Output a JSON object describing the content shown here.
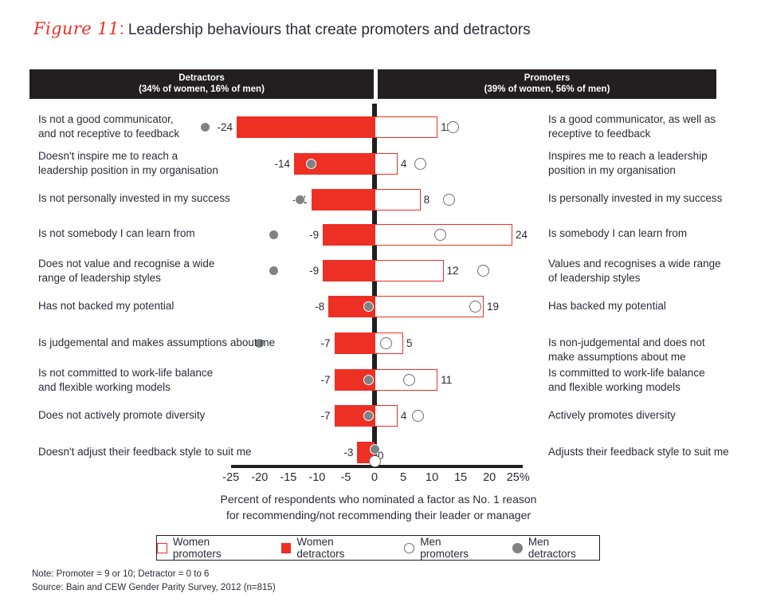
{
  "title": {
    "figure_number": "Figure 11",
    "colon": ":",
    "text": "Leadership behaviours that create promoters and detractors"
  },
  "header": {
    "detractors_title": "Detractors",
    "detractors_sub": "(34% of women, 16% of men)",
    "promoters_title": "Promoters",
    "promoters_sub": "(39% of women, 56% of men)"
  },
  "axis": {
    "ticks": [
      "-25",
      "-20",
      "-15",
      "-10",
      "-5",
      "0",
      "5",
      "10",
      "15",
      "20",
      "25%"
    ],
    "tick_values": [
      -25,
      -20,
      -15,
      -10,
      -5,
      0,
      5,
      10,
      15,
      20,
      25
    ],
    "caption_line1": "Percent of respondents who nominated a factor as No. 1 reason",
    "caption_line2": "for recommending/not recommending their leader or manager"
  },
  "legend": {
    "items": [
      {
        "label": "Women promoters",
        "swatch": "square-outline-red-icon",
        "color": "#ee2f24"
      },
      {
        "label": "Women detractors",
        "swatch": "square-filled-red-icon",
        "color": "#ee2f24"
      },
      {
        "label": "Men promoters",
        "swatch": "circle-outline-gray-icon",
        "color": "#6d6e71"
      },
      {
        "label": "Men detractors",
        "swatch": "circle-filled-gray-icon",
        "color": "#808284"
      }
    ]
  },
  "footnotes": {
    "note": "Note: Promoter = 9 or 10; Detractor = 0 to 6",
    "source": "Source: Bain and CEW Gender Parity Survey, 2012 (n=815)"
  },
  "colors": {
    "red": "#ee2f24",
    "black": "#231f20",
    "gray_marker": "#808284",
    "text": "#2b2b3a"
  },
  "chart_data": {
    "type": "bar",
    "orientation": "horizontal-diverging",
    "title": "Leadership behaviours that create promoters and detractors",
    "xlabel": "Percent of respondents who nominated a factor as No. 1 reason for recommending/not recommending their leader or manager",
    "ylabel": "",
    "xlim": [
      -25,
      25
    ],
    "grid": false,
    "legend_position": "bottom",
    "categories_left": [
      "Is not a good communicator, and not receptive to feedback",
      "Doesn't inspire me to reach a leadership position in my organisation",
      "Is not personally invested in my success",
      "Is not somebody I can learn from",
      "Does not value and recognise a wide range of leadership styles",
      "Has not backed my potential",
      "Is judgemental and makes assumptions about me",
      "Is not committed to work-life balance and flexible working models",
      "Does not actively promote diversity",
      "Doesn't adjust their feedback style to suit me"
    ],
    "categories_right": [
      "Is a good communicator, as well as receptive to feedback",
      "Inspires me to reach a leadership position in my organisation",
      "Is personally invested in my success",
      "Is somebody I can learn from",
      "Values and recognises a wide range of leadership styles",
      "Has backed my potential",
      "Is non-judgemental and does not make assumptions about me",
      "Is committed to work-life balance and flexible working models",
      "Actively promotes diversity",
      "Adjusts their feedback style to suit me"
    ],
    "series": [
      {
        "name": "Women detractors",
        "type": "bar",
        "values": [
          -24,
          -14,
          -11,
          -9,
          -9,
          -8,
          -7,
          -7,
          -7,
          -3
        ]
      },
      {
        "name": "Women promoters",
        "type": "bar",
        "values": [
          11,
          4,
          8,
          24,
          12,
          19,
          5,
          11,
          4,
          0
        ]
      },
      {
        "name": "Men detractors",
        "type": "marker",
        "values": [
          -29.5,
          -11,
          -13,
          -17.5,
          -17.5,
          -1,
          -20,
          -1,
          -1,
          0
        ]
      },
      {
        "name": "Men promoters",
        "type": "marker",
        "values": [
          13.6,
          8,
          13,
          11.5,
          19,
          17.5,
          2,
          6,
          7.5,
          0
        ]
      }
    ]
  },
  "rows": [
    {
      "left": "Is not a good communicator,\nand not receptive to feedback",
      "right": "Is a good communicator, as well as\nreceptive to feedback",
      "neg_label": "-24",
      "pos_label": "11"
    },
    {
      "left": "Doesn't inspire me to reach a\nleadership position in my organisation",
      "right": "Inspires me to reach a leadership\nposition in my organisation",
      "neg_label": "-14",
      "pos_label": "4"
    },
    {
      "left": "Is not personally invested in my success",
      "right": "Is personally invested in my success",
      "neg_label": "-11",
      "pos_label": "8"
    },
    {
      "left": "Is not somebody I can learn from",
      "right": "Is somebody I can learn from",
      "neg_label": "-9",
      "pos_label": "24"
    },
    {
      "left": "Does not value and recognise a wide\nrange of leadership styles",
      "right": "Values and recognises a wide range\nof leadership styles",
      "neg_label": "-9",
      "pos_label": "12"
    },
    {
      "left": "Has not backed my potential",
      "right": "Has backed my potential",
      "neg_label": "-8",
      "pos_label": "19"
    },
    {
      "left": "Is judgemental and makes assumptions about me",
      "right": "Is non-judgemental and does not\nmake assumptions about me",
      "neg_label": "-7",
      "pos_label": "5"
    },
    {
      "left": "Is not committed to work-life balance\nand flexible working models",
      "right": "Is committed to work-life balance\nand flexible working models",
      "neg_label": "-7",
      "pos_label": "11"
    },
    {
      "left": "Does not actively promote diversity",
      "right": "Actively promotes diversity",
      "neg_label": "-7",
      "pos_label": "4"
    },
    {
      "left": "Doesn't adjust their feedback style to suit me",
      "right": "Adjusts their feedback style to suit me",
      "neg_label": "-3",
      "pos_label": "0"
    }
  ]
}
